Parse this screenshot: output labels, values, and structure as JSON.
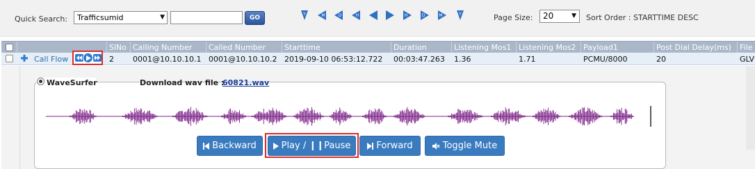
{
  "toolbar": {
    "quick_search_label": "Quick Search:",
    "quick_search_field": "Trafficsumid",
    "quick_search_value": "",
    "go_label": "GO",
    "nav_icons": [
      "Y",
      "M",
      "D",
      "H",
      "",
      "",
      "H",
      "D",
      "M",
      "Y"
    ],
    "page_size_label": "Page Size:",
    "page_size_value": "20",
    "sort_order_label": "Sort Order : STARTTIME DESC"
  },
  "grid": {
    "columns": [
      "SlNo",
      "Calling Number",
      "Called Number",
      "Starttime",
      "Duration",
      "Listening Mos1",
      "Listening Mos2",
      "Payload1",
      "Post Dial Delay(ms)",
      "File"
    ],
    "rows": [
      {
        "link": "Call Flow",
        "cells": [
          "2",
          "0001@10.10.10.1",
          "0001@10.10.10.2",
          "2019-09-10 06:53:12.722",
          "00:03:47.263",
          "1.36",
          "1.71",
          "PCMU/8000",
          "20",
          "GLV"
        ]
      }
    ]
  },
  "player": {
    "wavesurfer_label": "WaveSurfer",
    "download_label": "Download wav file :",
    "download_file": "60821.wav",
    "buttons": {
      "backward": "Backward",
      "play_pause": "Play / ❙❙Pause",
      "forward": "Forward",
      "toggle_mute": "Toggle Mute"
    }
  },
  "colors": {
    "accent_blue": "#3a7bc0",
    "wave_purple": "#7b1f86",
    "highlight_red": "#d92b2b",
    "header_gray": "#aab7c9"
  }
}
